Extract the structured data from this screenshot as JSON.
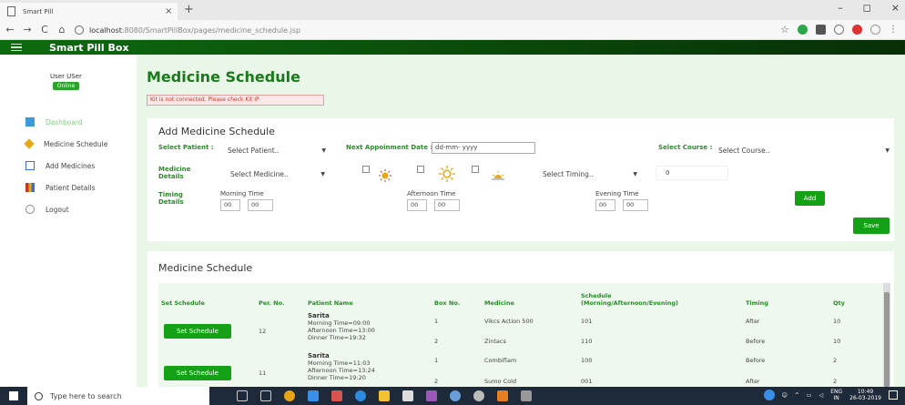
{
  "browser": {
    "tab_title": "Smart Pill",
    "tab_close": "×",
    "new_tab": "+",
    "url_host": "localhost",
    "url_path": ":8080/SmartPillBox/pages/medicine_schedule.jsp",
    "win_min": "–",
    "win_max": "◻",
    "win_close": "×",
    "back": "←",
    "forward": "→",
    "reload": "C",
    "home": "⌂",
    "star": "☆"
  },
  "app": {
    "brand": "Smart Pill Box"
  },
  "sidebar": {
    "user_name": "User USer",
    "status": "Online",
    "items": [
      {
        "label": "Dashboard",
        "icon": "dashboard-icon",
        "color": "#3a9ad9"
      },
      {
        "label": "Medicine Schedule",
        "icon": "schedule-icon",
        "color": "#e6a817"
      },
      {
        "label": "Add Medicines",
        "icon": "add-medicine-icon",
        "color": "#3a6fd9"
      },
      {
        "label": "Patient Details",
        "icon": "patient-icon",
        "color": "#c0392b"
      },
      {
        "label": "Logout",
        "icon": "logout-icon",
        "color": "#888888"
      }
    ]
  },
  "page": {
    "title": "Medicine Schedule",
    "alert": "Kit is not connected. Please check Kit IP"
  },
  "form": {
    "title": "Add Medicine Schedule",
    "select_patient_label": "Select Patient :",
    "select_patient_value": "Select Patient..",
    "next_appt_label": "Next Appoinment Date :",
    "next_appt_placeholder": "dd-mm- yyyy",
    "select_course_label": "Select Course :",
    "select_course_value": "Select Course..",
    "medicine_details_label_1": "Medicine",
    "medicine_details_label_2": "Details",
    "select_medicine_value": "Select Medicine..",
    "select_timing_value": "Select Timing..",
    "qty_value": "0",
    "timing_details_label_1": "Timing",
    "timing_details_label_2": "Details",
    "morning_label": "Morning Time",
    "afternoon_label": "Afternoon Time",
    "evening_label": "Evening Time",
    "morning_h": "00",
    "morning_m": "00",
    "afternoon_h": "00",
    "afternoon_m": "00",
    "evening_h": "00",
    "evening_m": "00",
    "add_label": "Add",
    "save_label": "Save"
  },
  "table": {
    "title": "Medicine Schedule",
    "headers": {
      "set_schedule": "Set Schedule",
      "per_no": "Per. No.",
      "patient_name": "Patient Name",
      "box_no": "Box No.",
      "medicine": "Medicine",
      "schedule_1": "Schedule",
      "schedule_2": "(Morning/Afternoon/Evening)",
      "timing": "Timing",
      "qty": "Qty"
    },
    "rows": [
      {
        "button": "Set Schedule",
        "per_no": "12",
        "patient_name": "Sarita",
        "times_1": "Morning Time=09:00",
        "times_2": "Afternoon Time=13:00",
        "times_3": "Dinner Time=19:32",
        "sub": [
          {
            "box": "1",
            "medicine": "Vikcs Action 500",
            "schedule": "101",
            "timing": "After",
            "qty": "10"
          },
          {
            "box": "2",
            "medicine": "Zintacs",
            "schedule": "110",
            "timing": "Before",
            "qty": "10"
          }
        ]
      },
      {
        "button": "Set Schedule",
        "per_no": "11",
        "patient_name": "Sarita",
        "times_1": "Morning Time=11:03",
        "times_2": "Afternoon Time=13:24",
        "times_3": "Dinner Time=19:20",
        "sub": [
          {
            "box": "1",
            "medicine": "Combiflam",
            "schedule": "100",
            "timing": "Before",
            "qty": "2"
          },
          {
            "box": "2",
            "medicine": "Sumo Cold",
            "schedule": "001",
            "timing": "After",
            "qty": "2"
          }
        ]
      }
    ]
  },
  "taskbar": {
    "search_placeholder": "Type here to search",
    "lang_1": "ENG",
    "lang_2": "IN",
    "time": "10:49",
    "date": "26-03-2019"
  }
}
